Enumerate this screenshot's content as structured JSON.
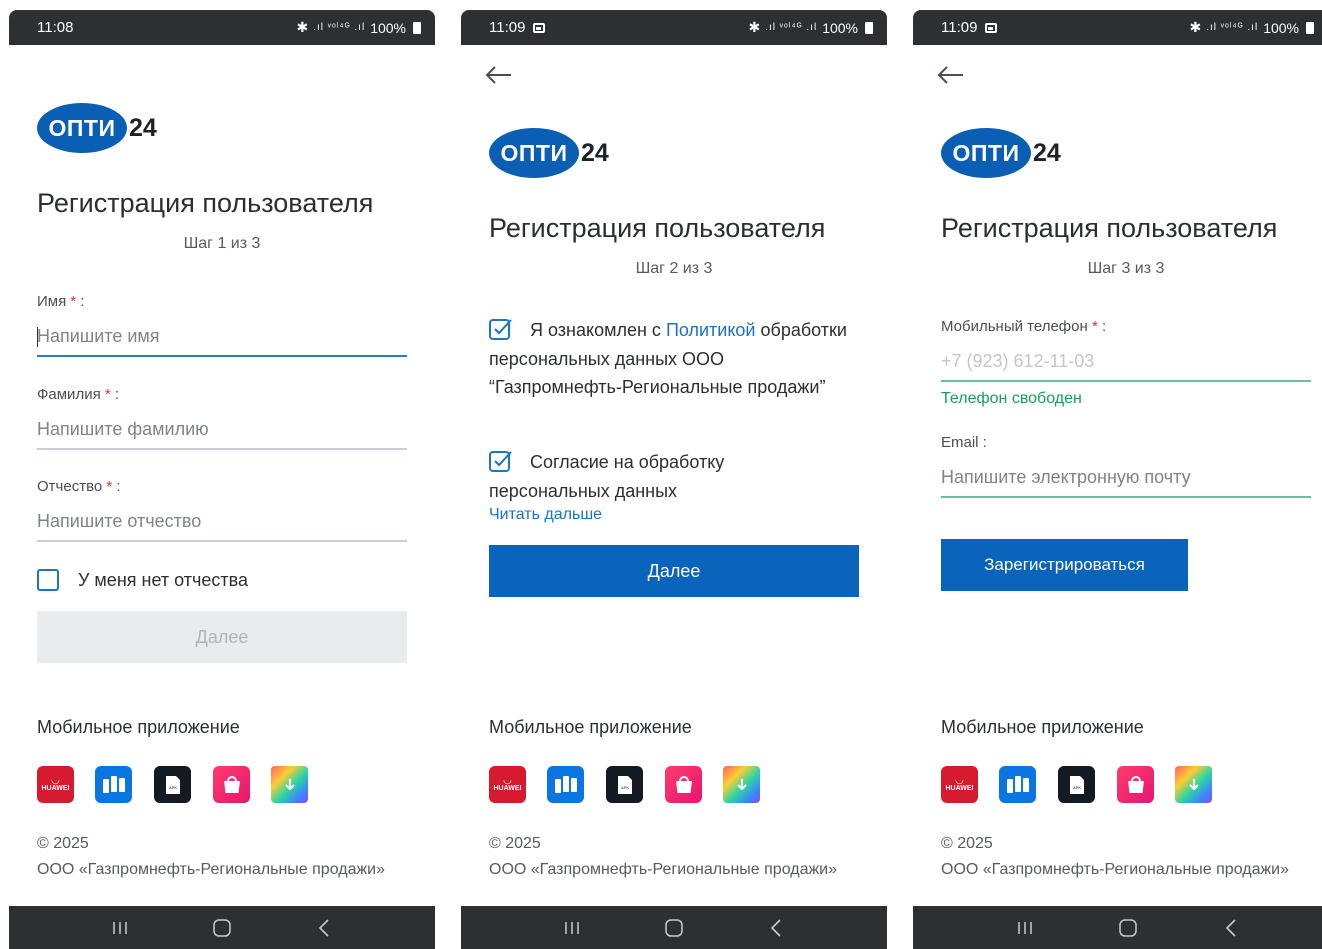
{
  "screens": [
    {
      "status": {
        "time": "11:08",
        "battery": "100%",
        "icons": ".ıl ᵛᵒˡ⁴ᴳ .ıl"
      },
      "logo": {
        "brand": "ОПТИ",
        "num": "24"
      },
      "title": "Регистрация пользователя",
      "step": "Шаг 1 из 3",
      "fields": {
        "first_name": {
          "label": "Имя",
          "req": "*",
          "suffix": " :",
          "placeholder": "Напишите имя"
        },
        "last_name": {
          "label": "Фамилия",
          "req": "*",
          "suffix": " :",
          "placeholder": "Напишите фамилию"
        },
        "patronymic": {
          "label": "Отчество",
          "req": "*",
          "suffix": " :",
          "placeholder": "Напишите отчество"
        }
      },
      "no_patronymic": "У меня нет отчества",
      "next": "Далее"
    },
    {
      "status": {
        "time": "11:09",
        "battery": "100%",
        "icons": ".ıl ᵛᵒˡ⁴ᴳ .ıl"
      },
      "logo": {
        "brand": "ОПТИ",
        "num": "24"
      },
      "title": "Регистрация пользователя",
      "step": "Шаг 2 из 3",
      "policy": {
        "pre": "Я ознакомлен с ",
        "link": "Политикой",
        "rest": "обработки персональных данных ООО “Газпромнефть-Региональные продажи”"
      },
      "consent": {
        "line1": "Согласие на обработку",
        "line2": "персональных данных"
      },
      "read_more": "Читать дальше",
      "next": "Далее"
    },
    {
      "status": {
        "time": "11:09",
        "battery": "100%",
        "icons": ".ıl ᵛᵒˡ⁴ᴳ .ıl"
      },
      "logo": {
        "brand": "ОПТИ",
        "num": "24"
      },
      "title": "Регистрация пользователя",
      "step": "Шаг 3 из 3",
      "phone": {
        "label": "Мобильный телефон",
        "req": "*",
        "suffix": " :",
        "placeholder": "+7 (923) 612-11-03",
        "status": "Телефон свободен"
      },
      "email": {
        "label": "Email",
        "suffix": " :",
        "placeholder": "Напишите электронную почту"
      },
      "register": "Зарегистрироваться"
    }
  ],
  "footer": {
    "apps_title": "Мобильное приложение",
    "huawei": "HUAWEI",
    "apk": "APK",
    "copyright": "© 2025",
    "company": "ООО «Газпромнефть-Региональные продажи»"
  },
  "colors": {
    "accent": "#0a64bb",
    "success": "#17a058",
    "required": "#e0312b"
  }
}
